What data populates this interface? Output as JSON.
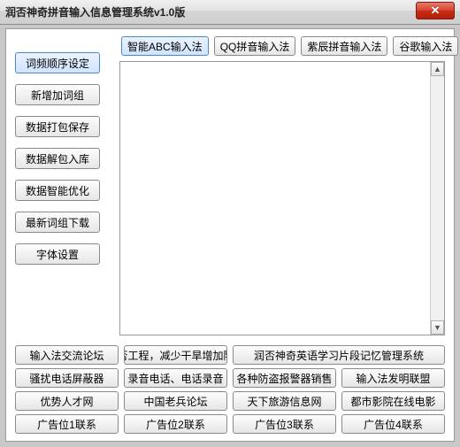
{
  "window": {
    "title": "润否神奇拼音输入信息管理系统v1.0版"
  },
  "ime_buttons": [
    {
      "label": "智能ABC输入法",
      "selected": true
    },
    {
      "label": "QQ拼音输入法",
      "selected": false
    },
    {
      "label": "紫辰拼音输入法",
      "selected": false
    },
    {
      "label": "谷歌输入法",
      "selected": false
    }
  ],
  "sidebar": [
    {
      "label": "词频顺序设定",
      "selected": true
    },
    {
      "label": "新增加词组",
      "selected": false
    },
    {
      "label": "数据打包保存",
      "selected": false
    },
    {
      "label": "数据解包入库",
      "selected": false
    },
    {
      "label": "数据智能优化",
      "selected": false
    },
    {
      "label": "最新词组下载",
      "selected": false
    },
    {
      "label": "字体设置",
      "selected": false
    }
  ],
  "textarea": {
    "content": ""
  },
  "bottom_links": {
    "row1": [
      "输入法交流论坛",
      "润否工程，减少干旱增加降雨",
      "润否神奇英语学习片段记忆管理系统"
    ],
    "row2": [
      "骚扰电话屏蔽器",
      "录音电话、电话录音",
      "各种防盗报警器销售",
      "输入法发明联盟"
    ],
    "row3": [
      "优势人才网",
      "中国老兵论坛",
      "天下旅游信息网",
      "都市影院在线电影"
    ],
    "row4": [
      "广告位1联系",
      "广告位2联系",
      "广告位3联系",
      "广告位4联系"
    ]
  }
}
